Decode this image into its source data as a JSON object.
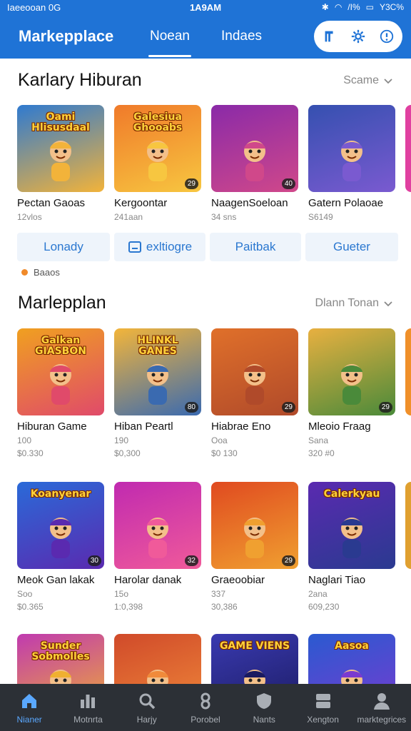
{
  "status_bar": {
    "carrier": "Iaeeooan 0G",
    "time": "1A9AM",
    "battery": "Y3C%",
    "signal": "/I%"
  },
  "header": {
    "title": "Markepplace",
    "tabs": [
      {
        "label": "Noean",
        "active": true
      },
      {
        "label": "Indaes",
        "active": false
      }
    ],
    "accent": "#1f73d6"
  },
  "section1": {
    "title": "Karlary Hiburan",
    "sort_label": "Scame",
    "items": [
      {
        "thumb_title": "Oami Hlisusdaal",
        "name": "Pectan Gaoas",
        "sub": "12vlos",
        "badge": "",
        "colors": [
          "#2f7ad0",
          "#f2b33a"
        ]
      },
      {
        "thumb_title": "Galesiua Ghooabs",
        "name": "Kergoontar",
        "sub": "241aan",
        "badge": "29",
        "colors": [
          "#f07a2a",
          "#f7c640"
        ]
      },
      {
        "thumb_title": "",
        "name": "NaagenSoeloan",
        "sub": "34 sns",
        "badge": "40",
        "colors": [
          "#8a2aa8",
          "#d0488a"
        ]
      },
      {
        "thumb_title": "",
        "name": "Gatern Polaoae",
        "sub": "S6149",
        "badge": "",
        "colors": [
          "#3550b0",
          "#7a5ad0"
        ]
      }
    ]
  },
  "chips": [
    {
      "label": "Lonady",
      "icon": ""
    },
    {
      "label": "exltiogre",
      "icon": "tag-icon"
    },
    {
      "label": "Paitbak",
      "icon": ""
    },
    {
      "label": "Gueter",
      "icon": ""
    }
  ],
  "note": "Baaos",
  "section2": {
    "title": "Marlepplan",
    "sort_label": "Dlann Tonan",
    "row1": [
      {
        "thumb_title": "Galkan GIASBON",
        "name": "Hiburan Game",
        "sub": "100",
        "sub2": "$0.330",
        "badge": "",
        "colors": [
          "#f0a020",
          "#e04a6a"
        ]
      },
      {
        "thumb_title": "HLINKL GANES",
        "name": "Hiban Peartl",
        "sub": "190",
        "sub2": "$0,300",
        "badge": "80",
        "colors": [
          "#f3b53a",
          "#3a6ab0"
        ]
      },
      {
        "thumb_title": "",
        "name": "Hiabrae Eno",
        "sub": "Ooa",
        "sub2": "$0 130",
        "badge": "29",
        "colors": [
          "#e0702a",
          "#b04a2a"
        ]
      },
      {
        "thumb_title": "",
        "name": "Mleoio Fraag",
        "sub": "Sana",
        "sub2": "320 #0",
        "badge": "29",
        "colors": [
          "#e8b040",
          "#4a8a3a"
        ]
      }
    ],
    "row2": [
      {
        "thumb_title": "Koanyenar",
        "name": "Meok Gan lakak",
        "sub": "Soo",
        "sub2": "$0.365",
        "badge": "30",
        "colors": [
          "#2a6ad8",
          "#5a2ab0"
        ]
      },
      {
        "thumb_title": "",
        "name": "Harolar danak",
        "sub": "15o",
        "sub2": "1:0,398",
        "badge": "32",
        "colors": [
          "#c02ab0",
          "#f05a9a"
        ]
      },
      {
        "thumb_title": "",
        "name": "Graeoobiar",
        "sub": "337",
        "sub2": "30,386",
        "badge": "29",
        "colors": [
          "#e04a20",
          "#f0a030"
        ]
      },
      {
        "thumb_title": "Calerkyau",
        "name": "Naglari Tiao",
        "sub": "2ana",
        "sub2": "609,230",
        "badge": "",
        "colors": [
          "#5a2ab0",
          "#2a3a90"
        ]
      }
    ],
    "row3": [
      {
        "thumb_title": "Sunder Sobmolles",
        "colors": [
          "#c03ab0",
          "#f0b030"
        ]
      },
      {
        "thumb_title": "",
        "colors": [
          "#d04a2a",
          "#f08a3a"
        ]
      },
      {
        "thumb_title": "GAME VIENS",
        "colors": [
          "#3a3ab0",
          "#1a1a60"
        ]
      },
      {
        "thumb_title": "Aasoa",
        "colors": [
          "#2a5ad0",
          "#7a3ad0"
        ]
      }
    ]
  },
  "bottom_nav": [
    {
      "label": "Nianer",
      "icon": "home-icon",
      "active": true
    },
    {
      "label": "Motnrta",
      "icon": "bar-chart-icon",
      "active": false
    },
    {
      "label": "Harjy",
      "icon": "search-icon",
      "active": false
    },
    {
      "label": "Porobel",
      "icon": "link-icon",
      "active": false
    },
    {
      "label": "Nants",
      "icon": "shield-icon",
      "active": false
    },
    {
      "label": "Xengton",
      "icon": "storage-icon",
      "active": false
    },
    {
      "label": "marktegrices",
      "icon": "profile-icon",
      "active": false
    }
  ]
}
